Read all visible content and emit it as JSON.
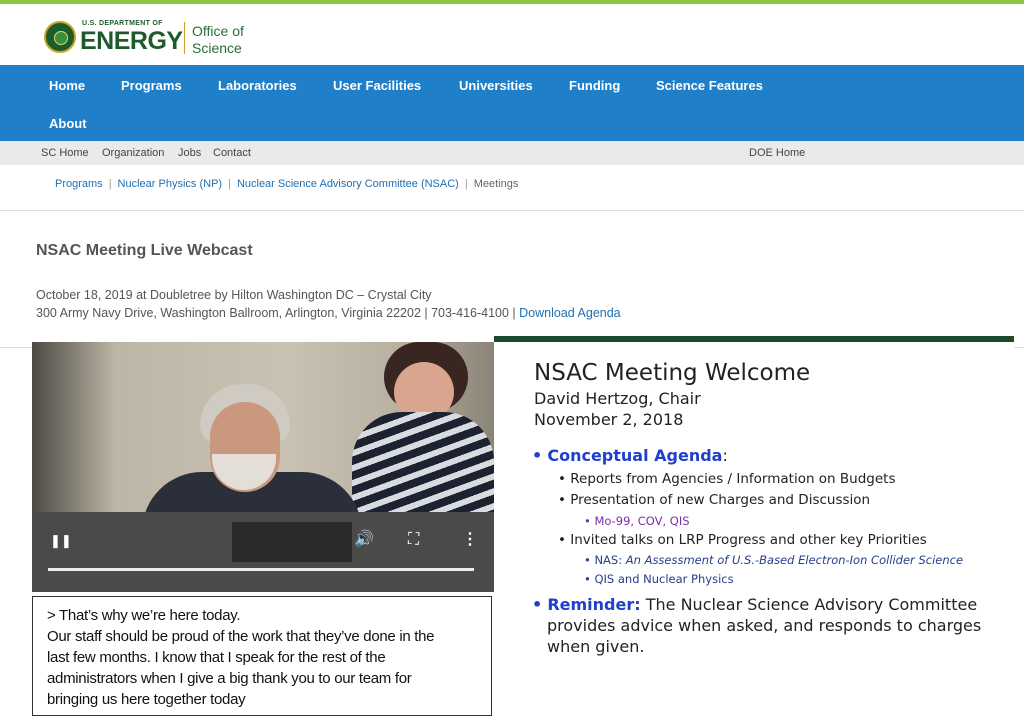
{
  "brand": {
    "dept": "U.S. DEPARTMENT OF",
    "energy": "ENERGY",
    "office_line1": "Office of",
    "office_line2": "Science"
  },
  "main_nav": [
    "Home",
    "Programs",
    "Laboratories",
    "User Facilities",
    "Universities",
    "Funding",
    "Science Features",
    "About"
  ],
  "util_nav": {
    "left": [
      "SC Home",
      "Organization",
      "Jobs",
      "Contact"
    ],
    "right": "DOE Home"
  },
  "breadcrumb": {
    "links": [
      "Programs",
      "Nuclear Physics (NP)",
      "Nuclear Science Advisory Committee (NSAC)"
    ],
    "current": "Meetings",
    "separator": "|"
  },
  "page": {
    "title": "NSAC Meeting Live Webcast",
    "date_line": "October 18, 2019 at Doubletree by Hilton Washington DC – Crystal City",
    "address_line": "300 Army Navy Drive, Washington Ballroom, Arlington, Virginia 22202 | 703-416-4100 |",
    "agenda_link": "Download Agenda"
  },
  "video": {
    "controls": [
      "pause-icon",
      "volume-icon",
      "fullscreen-icon",
      "more-options-icon"
    ],
    "glyphs": {
      "pause": "❚❚",
      "volume": "🔊",
      "fullscreen": "⛶",
      "more": "⋮"
    },
    "caption": [
      "> That’s why we’re here today.",
      "Our staff should be proud of the work that they’ve done in the",
      "last few months. I know that I speak for the rest of the",
      "administrators when I give a big thank you to our team for",
      "bringing us here together today"
    ]
  },
  "slide": {
    "title": "NSAC Meeting Welcome",
    "subtitle_line1": "David Hertzog, Chair",
    "subtitle_line2": "November 2, 2018",
    "agenda_label": "Conceptual Agenda",
    "agenda_colon": ":",
    "items": [
      "Reports from Agencies / Information on Budgets",
      "Presentation of new Charges and Discussion",
      "Invited talks on LRP Progress and other key Priorities"
    ],
    "sub_charges": "Mo-99, COV, QIS",
    "nas_prefix": "NAS: ",
    "nas_title": "An Assessment of U.S.-Based Electron-Ion Collider Science",
    "qis": "QIS and Nuclear Physics",
    "reminder_label": "Reminder:",
    "reminder_lines": [
      "The Nuclear Science Advisory Committee",
      "provides advice when asked, and responds to charges",
      "when given."
    ]
  },
  "colors": {
    "nav_blue": "#1f7fc9",
    "brand_green": "#1e5a2c",
    "accent_lime": "#8dc63f",
    "link_blue": "#1f6fb2",
    "slide_blue": "#1f3fcf",
    "slide_purple": "#7a2fa8"
  }
}
